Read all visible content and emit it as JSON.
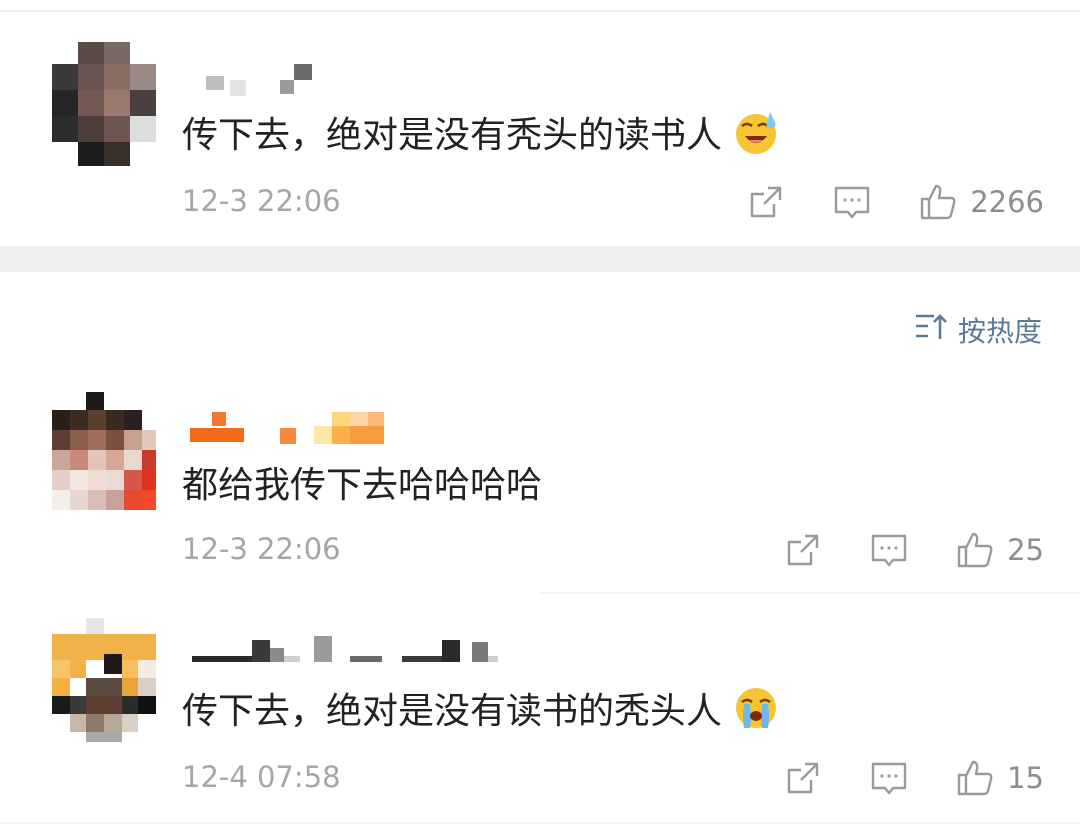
{
  "sort": {
    "label": "按热度"
  },
  "comments": [
    {
      "text": "传下去，绝对是没有秃头的读书人",
      "emoji": "sweat-laugh-emoji",
      "time": "12-3 22:06",
      "likes": "2266"
    },
    {
      "text": "都给我传下去哈哈哈哈",
      "time": "12-3 22:06",
      "likes": "25"
    },
    {
      "text": "传下去，绝对是没有读书的秃头人",
      "emoji": "crying-emoji",
      "time": "12-4 07:58",
      "likes": "15"
    }
  ],
  "colors": {
    "meta_gray": "#a6a6a6",
    "sort_blue": "#5b7b9a",
    "text": "#222222"
  }
}
